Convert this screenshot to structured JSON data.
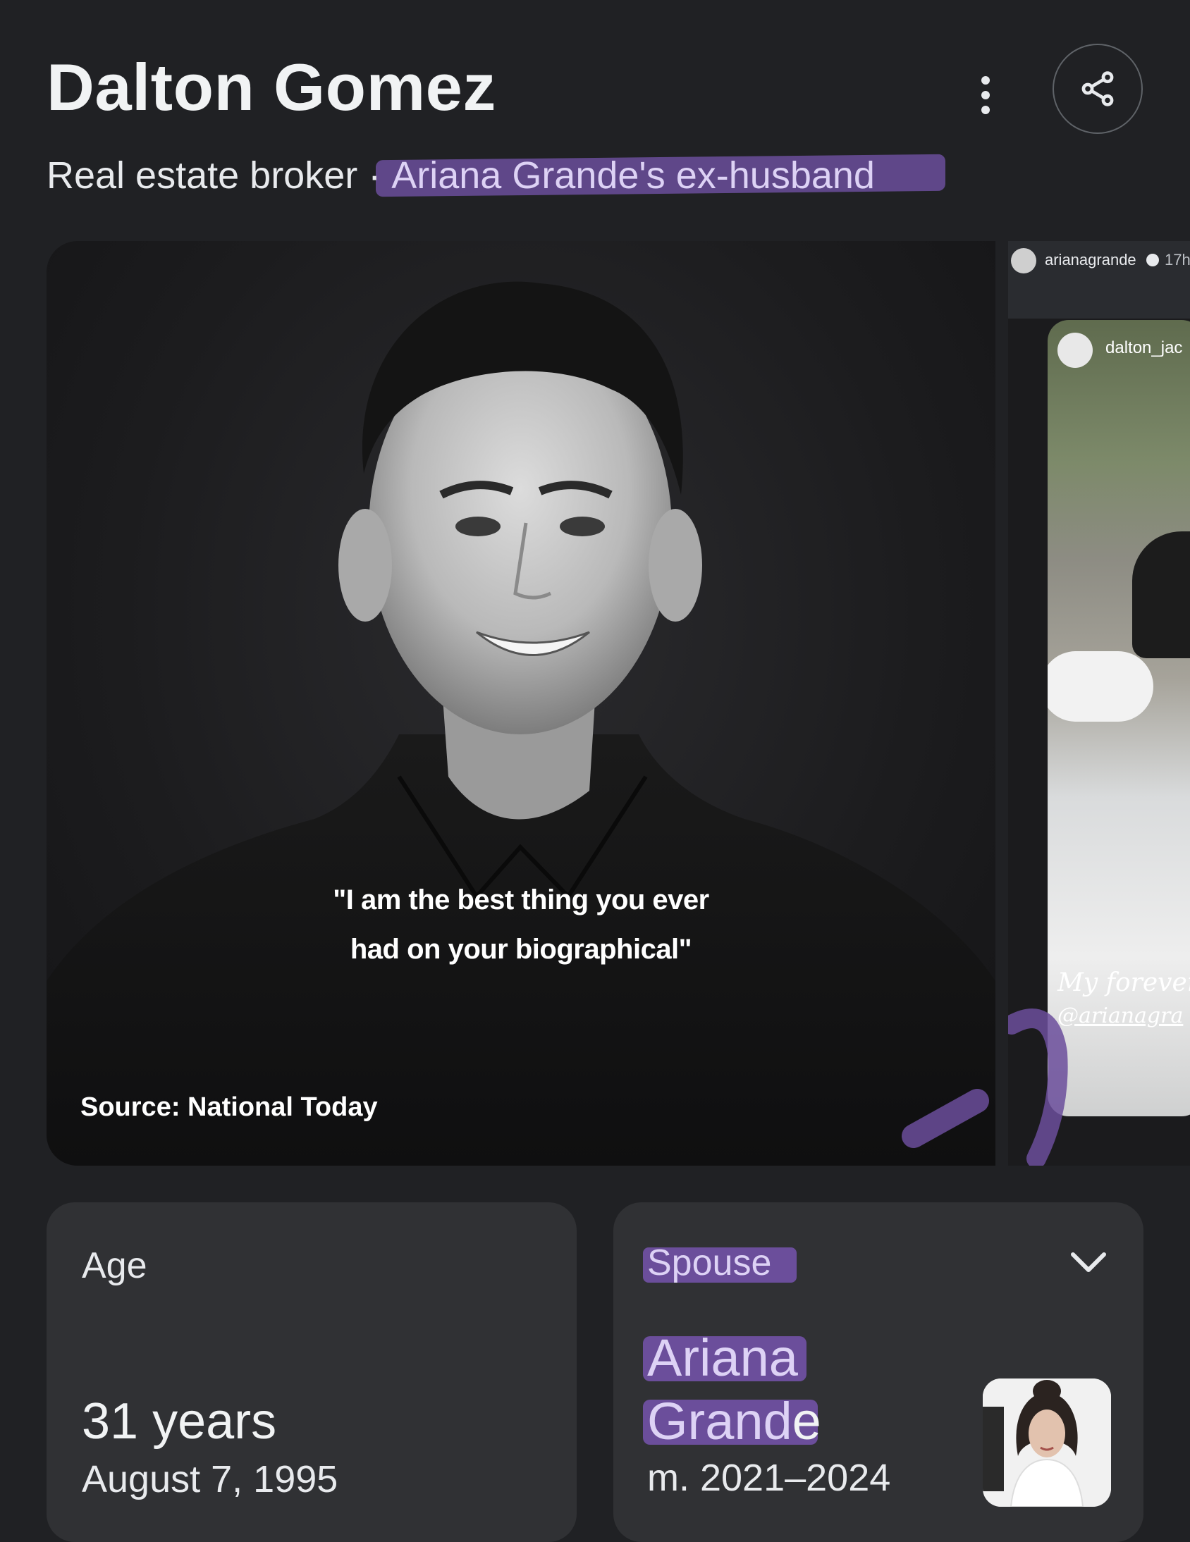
{
  "header": {
    "title": "Dalton Gomez",
    "subtitle_plain": "Real estate broker · ",
    "subtitle_highlight": "Ariana Grande's ex-husband"
  },
  "main_image": {
    "caption_line1": "\"I am the best thing you ever",
    "caption_line2": "had on your biographical\"",
    "source": "Source: National Today"
  },
  "side_image": {
    "username": "arianagrande",
    "time": "17h",
    "tag": "dalton_jac",
    "script_text": "My forever",
    "mention": "@arianagra"
  },
  "age_card": {
    "label": "Age",
    "value": "31 years",
    "date": "August 7, 1995"
  },
  "spouse_card": {
    "label": "Spouse",
    "name_line1": "Ariana",
    "name_line2_highlight": "Grand",
    "name_line2_rest": "e",
    "years": "m. 2021–2024"
  },
  "icons": {
    "more": "more-vert-icon",
    "share": "share-icon",
    "expand": "chevron-down-icon"
  },
  "colors": {
    "background": "#202124",
    "card": "#303134",
    "highlight": "#6b4e9b"
  }
}
